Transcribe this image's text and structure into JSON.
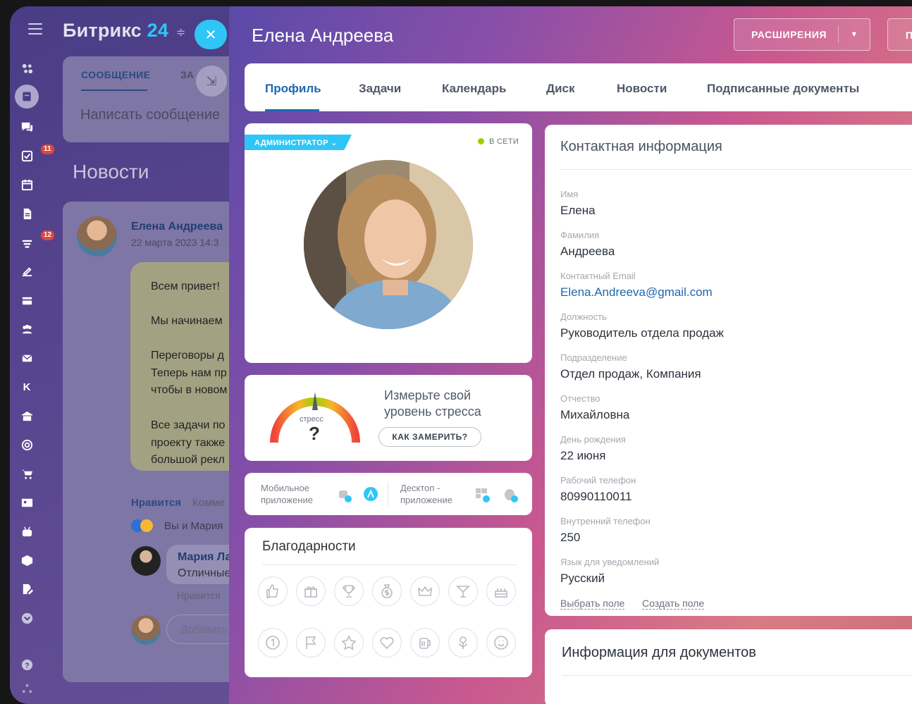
{
  "app": {
    "logo_main": "Битрикс",
    "logo_num": "24"
  },
  "rail": {
    "badges": {
      "tasks": "11",
      "feed": "12"
    },
    "letter": "K"
  },
  "background": {
    "tab_message": "СООБЩЕНИЕ",
    "tab_second": "ЗА",
    "write_placeholder": "Написать сообщение",
    "news_title": "Новости",
    "post_author": "Елена Андреева",
    "post_date": "22 марта 2023 14:3",
    "post_lines": [
      "Всем привет!",
      "Мы начинаем",
      "Переговоры д\nТеперь нам пр\nчтобы в новом",
      "Все задачи по\nпроекту также\nбольшой рекл"
    ],
    "like": "Нравится",
    "comment": "Комме",
    "reactions": "Вы и Мария",
    "comment_author": "Мария Ла",
    "comment_text": "Отличные",
    "comment_like": "Нравится",
    "add_comment": "Добавить"
  },
  "profile": {
    "name": "Елена Андреева",
    "extensions_label": "РАСШИРЕНИЯ",
    "second_button": "П",
    "tabs": [
      "Профиль",
      "Задачи",
      "Календарь",
      "Диск",
      "Новости",
      "Подписанные документы"
    ],
    "role": "АДМИНИСТРАТОР",
    "status": "В СЕТИ",
    "stress": {
      "label": "стресс",
      "value": "?",
      "title": "Измерьте свой\nуровень стресса",
      "button": "КАК ЗАМЕРИТЬ?"
    },
    "apps": {
      "mobile": "Мобильное\nприложение",
      "desktop": "Десктоп -\nприложение"
    },
    "thanks_title": "Благодарности",
    "thanks_icons": [
      "thumbs-up-icon",
      "gift-icon",
      "trophy-icon",
      "money-bag-icon",
      "crown-icon",
      "cocktail-icon",
      "cake-icon",
      "number-one-icon",
      "flag-icon",
      "star-icon",
      "heart-icon",
      "beer-icon",
      "flower-icon",
      "smile-icon"
    ]
  },
  "contact": {
    "title": "Контактная информация",
    "fields": [
      {
        "label": "Имя",
        "value": "Елена"
      },
      {
        "label": "Фамилия",
        "value": "Андреева"
      },
      {
        "label": "Контактный Email",
        "value": "Elena.Andreeva@gmail.com"
      },
      {
        "label": "Должность",
        "value": "Руководитель отдела продаж"
      },
      {
        "label": "Подразделение",
        "value": "Отдел продаж, Компания"
      },
      {
        "label": "Отчество",
        "value": "Михайловна"
      },
      {
        "label": "День рождения",
        "value": "22 июня"
      },
      {
        "label": "Рабочий телефон",
        "value": "80990110011"
      },
      {
        "label": "Внутренний телефон",
        "value": "250"
      },
      {
        "label": "Язык для уведомлений",
        "value": "Русский"
      }
    ],
    "select_field": "Выбрать поле",
    "create_field": "Создать поле"
  },
  "documents": {
    "title": "Информация для документов"
  },
  "colors": {
    "accent": "#2067b0",
    "cyan": "#2fc6f6",
    "online": "#9dcf00",
    "badge": "#e0463a"
  }
}
